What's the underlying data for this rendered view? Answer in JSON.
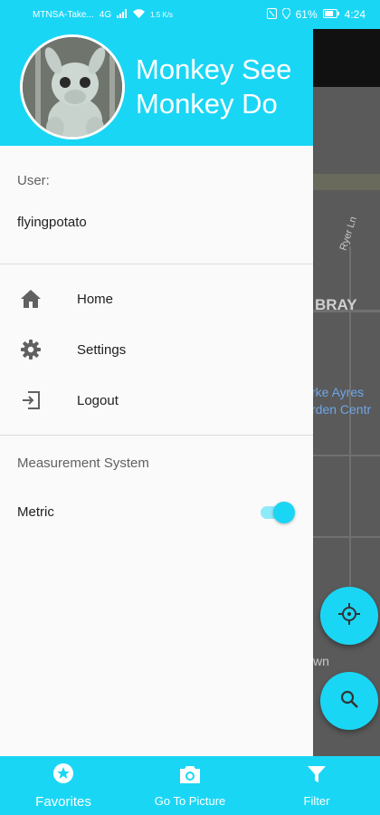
{
  "status_bar": {
    "carrier": "MTNSA-Take...",
    "network": "4G",
    "speed": "1.5 K/s",
    "battery": "61%",
    "time": "4:24"
  },
  "drawer": {
    "title": "Monkey See Monkey Do",
    "user_label": "User:",
    "username": "flyingpotato",
    "menu": [
      {
        "label": "Home",
        "icon": "home-icon"
      },
      {
        "label": "Settings",
        "icon": "gear-icon"
      },
      {
        "label": "Logout",
        "icon": "logout-icon"
      }
    ],
    "measurement_label": "Measurement System",
    "metric_label": "Metric",
    "metric_enabled": true
  },
  "map": {
    "labels": [
      "Ryer Ln",
      "BRAY",
      "rke Ayres",
      "rden Centr",
      "wn"
    ]
  },
  "fabs": [
    {
      "icon": "crosshair-icon"
    },
    {
      "icon": "search-icon"
    }
  ],
  "bottom_nav": [
    {
      "label": "Favorites",
      "icon": "star-icon"
    },
    {
      "label": "Go To Picture",
      "icon": "camera-icon"
    },
    {
      "label": "Filter",
      "icon": "filter-icon"
    }
  ],
  "colors": {
    "accent": "#1ad6f5",
    "map_dark": "#5a5a5a"
  }
}
